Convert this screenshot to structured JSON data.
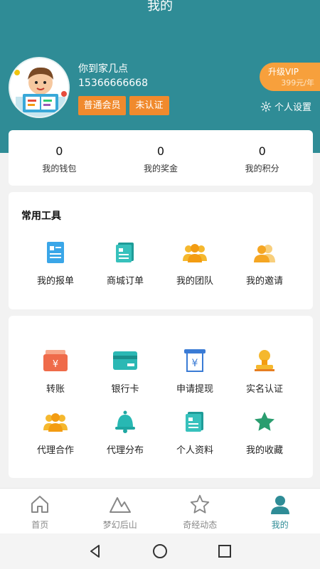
{
  "header": {
    "title": "我的",
    "username": "你到家几点",
    "phone": "15366666668",
    "member_tag": "普通会员",
    "auth_tag": "未认证",
    "vip_label": "升级VIP",
    "vip_price": "399元/年",
    "settings_label": "个人设置"
  },
  "stats": [
    {
      "value": "0",
      "label": "我的钱包"
    },
    {
      "value": "0",
      "label": "我的奖金"
    },
    {
      "value": "0",
      "label": "我的积分"
    }
  ],
  "tools": {
    "title": "常用工具",
    "items": [
      {
        "label": "我的报单",
        "icon": "report-icon"
      },
      {
        "label": "商城订单",
        "icon": "order-icon"
      },
      {
        "label": "我的团队",
        "icon": "team-icon"
      },
      {
        "label": "我的邀请",
        "icon": "invite-icon"
      }
    ]
  },
  "services": {
    "row1": [
      {
        "label": "转账",
        "icon": "transfer-icon"
      },
      {
        "label": "银行卡",
        "icon": "bank-card-icon"
      },
      {
        "label": "申请提现",
        "icon": "withdraw-icon"
      },
      {
        "label": "实名认证",
        "icon": "verify-icon"
      }
    ],
    "row2": [
      {
        "label": "代理合作",
        "icon": "agent-coop-icon"
      },
      {
        "label": "代理分布",
        "icon": "agent-distribution-icon"
      },
      {
        "label": "个人资料",
        "icon": "profile-icon"
      },
      {
        "label": "我的收藏",
        "icon": "favorites-icon"
      }
    ]
  },
  "tabbar": [
    {
      "label": "首页",
      "icon": "home-icon"
    },
    {
      "label": "梦幻后山",
      "icon": "mountain-icon"
    },
    {
      "label": "奇经动态",
      "icon": "star-icon"
    },
    {
      "label": "我的",
      "icon": "user-icon",
      "active": true
    }
  ],
  "colors": {
    "primary": "#2f8c96",
    "accent": "#f08a2d",
    "vip": "#f7a03c"
  }
}
